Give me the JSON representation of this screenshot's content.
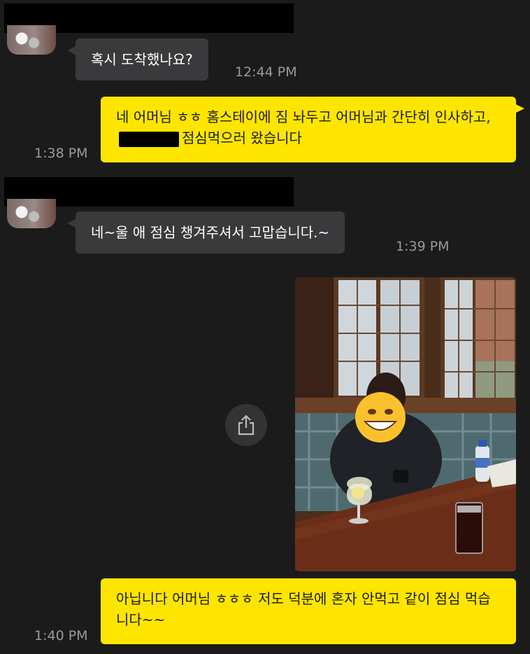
{
  "messages": [
    {
      "id": "m1",
      "from": "contact",
      "text": "혹시 도착했나요?",
      "time": "12:44 PM"
    },
    {
      "id": "m2",
      "from": "me",
      "text_before_redaction": "네 어머님 ㅎㅎ 홈스테이에 짐 놔두고 어머님과 간단히 인사하고,",
      "text_after_redaction": "점심먹으러 왔습니다",
      "time": "1:38 PM"
    },
    {
      "id": "m3",
      "from": "contact",
      "text": "네~울 애 점심 챙겨주셔서 고맙습니다.~",
      "time": "1:39 PM"
    },
    {
      "id": "m4",
      "from": "me",
      "type": "photo",
      "icon": "share-icon"
    },
    {
      "id": "m5",
      "from": "me",
      "text": "아닙니다 어머님 ㅎㅎㅎ 저도 덕분에 혼자 안먹고 같이 점심 먹습니다~~",
      "time": "1:40 PM"
    }
  ],
  "colors": {
    "background": "#1b1b1b",
    "incoming_bubble": "#3a3a3c",
    "outgoing_bubble": "#fee500",
    "timestamp": "#9a9a9a"
  }
}
